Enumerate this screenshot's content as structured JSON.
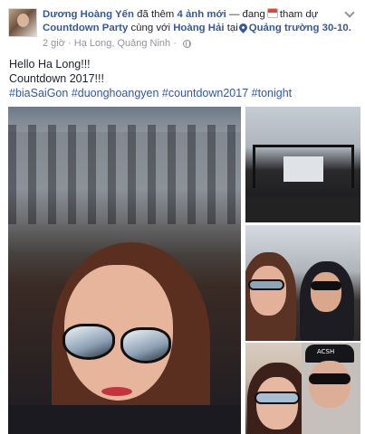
{
  "post": {
    "author": "Dương Hoàng Yến",
    "action_text": "đã thêm",
    "photo_count": "4 ảnh mới",
    "dash_text": "— đang",
    "event_verb": "tham dự",
    "event_name": "Countdown Party",
    "with_text": "cùng với",
    "tagged_person": "Hoàng Hải",
    "at_text": "tại",
    "place": "Quảng trường 30-10.",
    "time": "2 giờ",
    "location": "Hạ Long, Quảng Ninh",
    "separator": "·",
    "text_lines": [
      "Hello Ha Long!!!",
      "Countdown 2017!!!"
    ],
    "hashtags": [
      "#biaSaiGon",
      "#duonghoangyen",
      "#countdown2017",
      "#tonight"
    ],
    "cap_label": "ACSH"
  },
  "icons": {
    "event": "calendar-icon",
    "place": "map-pin-icon",
    "privacy": "globe-icon",
    "menu": "chevron-down-icon"
  },
  "colors": {
    "link": "#365899",
    "meta": "#90949c",
    "text": "#1d2129"
  }
}
